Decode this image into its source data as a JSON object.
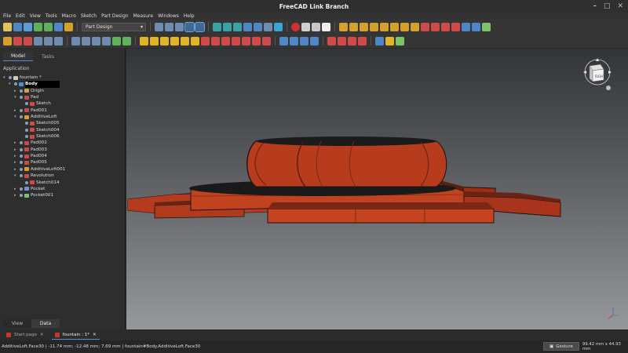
{
  "window": {
    "title": "FreeCAD Link Branch"
  },
  "menu": [
    "File",
    "Edit",
    "View",
    "Tools",
    "Macro",
    "Sketch",
    "Part Design",
    "Measure",
    "Windows",
    "Help"
  ],
  "toolbar": {
    "workbench": "Part Design"
  },
  "panel": {
    "tabs": [
      "Model",
      "Tasks"
    ],
    "application_label": "Application",
    "bottom_tabs": [
      "View",
      "Data"
    ]
  },
  "tree": [
    {
      "label": "fountain *",
      "level": 0,
      "expanded": true,
      "icon": "document-icon",
      "color": "#c9c9c9"
    },
    {
      "label": "Body",
      "level": 1,
      "expanded": true,
      "icon": "body-icon",
      "color": "#4f8fd0",
      "selected": true
    },
    {
      "label": "Origin",
      "level": 2,
      "expanded": false,
      "icon": "origin-icon",
      "color": "#c8a64a"
    },
    {
      "label": "Pad",
      "level": 2,
      "expanded": true,
      "icon": "pad-icon",
      "color": "#c94b4b"
    },
    {
      "label": "Sketch",
      "level": 3,
      "icon": "sketch-icon",
      "color": "#d04a4a"
    },
    {
      "label": "Pad001",
      "level": 2,
      "expanded": false,
      "icon": "pad-icon",
      "color": "#c94b4b"
    },
    {
      "label": "AdditiveLoft",
      "level": 2,
      "expanded": true,
      "icon": "loft-icon",
      "color": "#d6a02a"
    },
    {
      "label": "Sketch005",
      "level": 3,
      "icon": "sketch-icon",
      "color": "#d04a4a"
    },
    {
      "label": "Sketch004",
      "level": 3,
      "icon": "sketch-icon",
      "color": "#d04a4a"
    },
    {
      "label": "Sketch006",
      "level": 3,
      "icon": "sketch-icon",
      "color": "#d04a4a"
    },
    {
      "label": "Pad002",
      "level": 2,
      "expanded": false,
      "icon": "pad-icon",
      "color": "#c94b4b"
    },
    {
      "label": "Pad003",
      "level": 2,
      "expanded": false,
      "icon": "pad-icon",
      "color": "#c94b4b"
    },
    {
      "label": "Pad004",
      "level": 2,
      "expanded": false,
      "icon": "pad-icon",
      "color": "#c94b4b"
    },
    {
      "label": "Pad005",
      "level": 2,
      "expanded": false,
      "icon": "pad-icon",
      "color": "#c94b4b"
    },
    {
      "label": "AdditiveLoft001",
      "level": 2,
      "expanded": false,
      "icon": "loft-icon",
      "color": "#d6a02a"
    },
    {
      "label": "Revolution",
      "level": 2,
      "expanded": true,
      "icon": "revolution-icon",
      "color": "#c94b4b"
    },
    {
      "label": "Sketch014",
      "level": 3,
      "icon": "sketch-icon",
      "color": "#d04a4a"
    },
    {
      "label": "Pocket",
      "level": 2,
      "expanded": false,
      "icon": "pocket-icon",
      "color": "#7a8fd8"
    },
    {
      "label": "Pocket001",
      "level": 2,
      "expanded": false,
      "icon": "pocket-icon",
      "color": "#7cc46a"
    }
  ],
  "navcube": {
    "face_label": "RIGHT"
  },
  "doc_tabs": [
    {
      "label": "Start page",
      "active": false
    },
    {
      "label": "fountain : 1*",
      "active": true
    }
  ],
  "status": {
    "message": "AdditiveLoft.Face30 | -11.74 mm; -12.48 mm; 7.69 mm | fountain#Body.AdditiveLoft.Face30",
    "nav_style": "Gesture",
    "dimensions": "99.42 mm x 44.93 mm"
  },
  "colors": {
    "model_face": "#b53a1e",
    "model_edge": "#141414",
    "accent": "#4f8fd0"
  },
  "toolbar_icons_row1": [
    "new-icon",
    "open-icon",
    "save-icon",
    "undo-icon",
    "redo-icon",
    "refresh-icon",
    "cut-icon",
    "copy-icon",
    "paste-icon",
    "whats-this-icon",
    "workbench-select",
    "macro-record-icon",
    "macro-stop-icon",
    "macro-edit-icon",
    "macro-run-icon",
    "view-fit-icon",
    "view-selection-icon",
    "draw-style-icon",
    "back-icon",
    "forward-icon",
    "up-icon",
    "down-icon",
    "std-link-icon",
    "measure-icon"
  ],
  "toolbar_icons_row2": [
    "part-icon",
    "body-icon",
    "sketch-icon",
    "pad-icon",
    "revolution-icon",
    "loft-icon",
    "pipe-icon",
    "pocket-icon",
    "hole-icon",
    "groove-icon",
    "fillet-icon",
    "chamfer-icon",
    "draft-icon",
    "thickness-icon",
    "mirror-icon",
    "pattern-icon",
    "boolean-icon",
    "datum-point-icon",
    "datum-line-icon",
    "datum-plane-icon"
  ]
}
